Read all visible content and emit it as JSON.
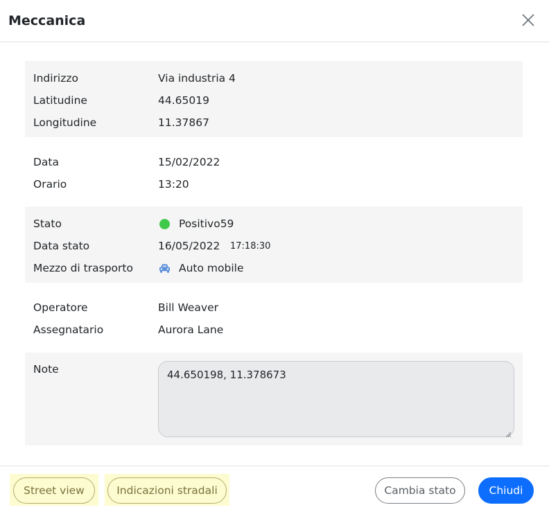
{
  "modal": {
    "title": "Meccanica"
  },
  "location": {
    "address_label": "Indirizzo",
    "address_value": "Via industria 4",
    "lat_label": "Latitudine",
    "lat_value": "44.65019",
    "lon_label": "Longitudine",
    "lon_value": "11.37867"
  },
  "schedule": {
    "date_label": "Data",
    "date_value": "15/02/2022",
    "time_label": "Orario",
    "time_value": "13:20"
  },
  "status": {
    "state_label": "Stato",
    "state_value": "Positivo59",
    "state_color": "#3ec94b",
    "state_date_label": "Data stato",
    "state_date_value": "16/05/2022",
    "state_time_value": "17:18:30",
    "transport_label": "Mezzo di trasporto",
    "transport_value": "Auto mobile",
    "transport_icon": "car-icon",
    "transport_icon_color": "#5b8fd9"
  },
  "people": {
    "operator_label": "Operatore",
    "operator_value": "Bill Weaver",
    "assignee_label": "Assegnatario",
    "assignee_value": "Aurora Lane"
  },
  "notes": {
    "label": "Note",
    "value": "44.650198, 11.378673"
  },
  "footer": {
    "street_view_label": "Street view",
    "directions_label": "Indicazioni stradali",
    "change_state_label": "Cambia stato",
    "close_label": "Chiudi"
  },
  "colors": {
    "primary": "#0d6efd",
    "section_bg": "#f5f5f5",
    "highlight": "#fdfbd0"
  }
}
